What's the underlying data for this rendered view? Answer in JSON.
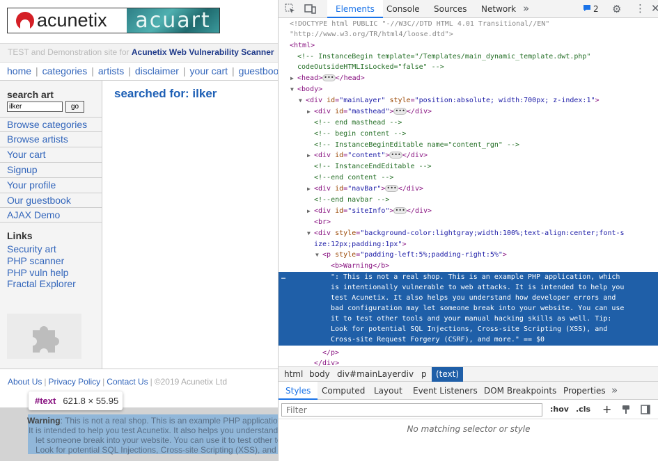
{
  "site": {
    "logo_left": "acunetix",
    "logo_right": "acuart",
    "info_prefix": "TEST and Demonstration site for ",
    "info_brand": "Acunetix Web Vulnerability Scanner",
    "nav": [
      "home",
      "categories",
      "artists",
      "disclaimer",
      "your cart",
      "guestbook"
    ],
    "search": {
      "title": "search art",
      "value": "ilker",
      "button": "go"
    },
    "sidebar_links": [
      "Browse categories",
      "Browse artists",
      "Your cart",
      "Signup",
      "Your profile",
      "Our guestbook",
      "AJAX Demo"
    ],
    "links_title": "Links",
    "links": [
      "Security art",
      "PHP scanner",
      "PHP vuln help",
      "Fractal Explorer"
    ],
    "heading": "searched for: ilker",
    "footer": {
      "about": "About Us",
      "privacy": "Privacy Policy",
      "contact": "Contact Us",
      "copyright": "©2019 Acunetix Ltd"
    },
    "tooltip": {
      "node": "#text",
      "dims": "621.8 × 55.95"
    },
    "warning": {
      "label": "Warning",
      "lines": [
        ": This is not a real shop. This is an example PHP application",
        "It is intended to help you test Acunetix. It also helps you understand",
        "let someone break into your website. You can use it to test other tools",
        "Look for potential SQL Injections, Cross-site Scripting (XSS), and Cross-site"
      ]
    }
  },
  "devtools": {
    "tabs": [
      "Elements",
      "Console",
      "Sources",
      "Network"
    ],
    "issues_count": "2",
    "dom": {
      "doctype": "<!DOCTYPE html PUBLIC \"-//W3C//DTD HTML 4.01 Transitional//EN\"",
      "doctype2": "\"http://www.w3.org/TR/html4/loose.dtd\">",
      "html": "<html>",
      "c_instance1": "<!-- InstanceBegin template=\"/Templates/main_dynamic_template.dwt.php\"",
      "c_instance2": "codeOutsideHTMLIsLocked=\"false\" -->",
      "head_open": "<head>",
      "head_close": "</head>",
      "body": "<body>",
      "div_open": "<div",
      "attr_id": "id",
      "attr_style": "style",
      "main_id": "\"mainLayer\"",
      "main_style": "\"position:absolute; width:700px; z-index:1\"",
      "masthead_id": "\"masthead\"",
      "content_id": "\"content\"",
      "navbar_id": "\"navBar\"",
      "siteinfo_id": "\"siteInfo\"",
      "div_close": "</div>",
      "c_end_masthead": "<!-- end masthead -->",
      "c_begin_content": "<!-- begin content -->",
      "c_instance_editable": "<!-- InstanceBeginEditable name=\"content_rgn\" -->",
      "c_instance_end_editable": "<!-- InstanceEndEditable -->",
      "c_end_content": "<!--end content -->",
      "c_end_navbar": "<!--end navbar -->",
      "br": "<br>",
      "div_style_1": "\"background-color:lightgray;width:100%;text-align:center;font-s",
      "div_style_2": "ize:12px;padding:1px\"",
      "p_open": "<p",
      "p_style": "\"padding-left:5%;padding-right:5%\"",
      "b_warning": "<b>Warning</b>",
      "text_lines": [
        "\": This is not a real shop. This is an example PHP application, which",
        "is intentionally vulnerable to web attacks. It is intended to help you",
        "test Acunetix. It also helps you understand how developer errors and",
        "bad configuration may let someone break into your website. You can use",
        "it to test other tools and your manual hacking skills as well. Tip:",
        "Look for potential SQL Injections, Cross-site Scripting (XSS), and",
        "Cross-site Request Forgery (CSRF), and more.\" == $0"
      ],
      "p_close": "</p>",
      "div_close2": "</div>"
    },
    "breadcrumbs": [
      "html",
      "body",
      "div#mainLayer",
      "div",
      "p",
      "(text)"
    ],
    "sub_tabs": [
      "Styles",
      "Computed",
      "Layout",
      "Event Listeners",
      "DOM Breakpoints",
      "Properties"
    ],
    "filter_placeholder": "Filter",
    "hov": ":hov",
    "cls": ".cls",
    "no_match": "No matching selector or style"
  }
}
